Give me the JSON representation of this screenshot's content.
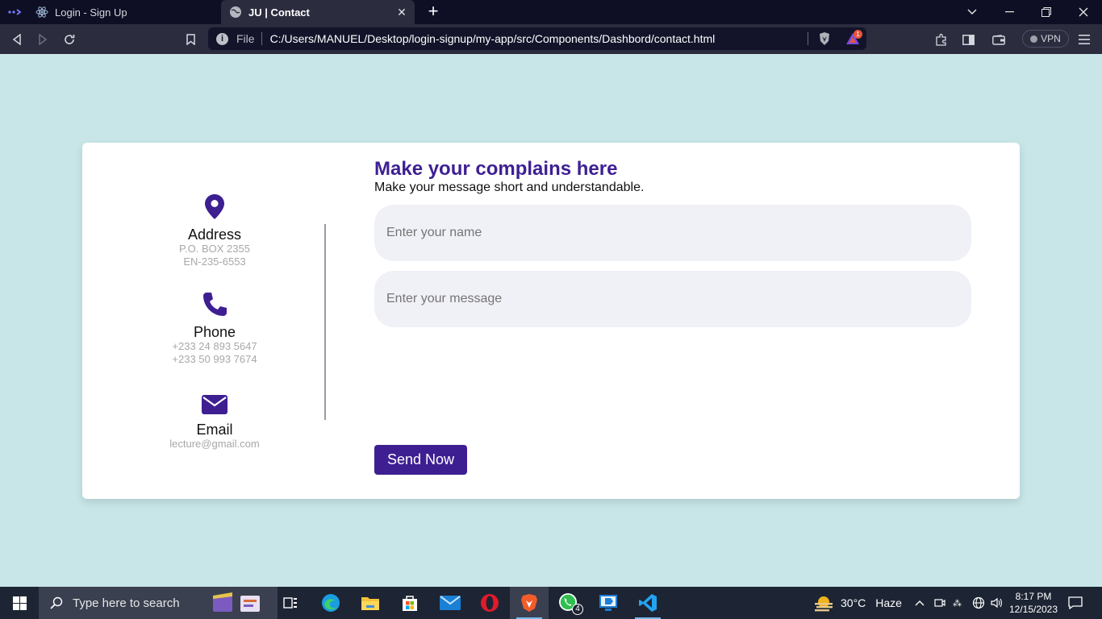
{
  "browser": {
    "tabs": [
      {
        "title": "Login - Sign Up",
        "active": false
      },
      {
        "title": "JU | Contact",
        "active": true
      }
    ],
    "url_scheme": "File",
    "url": "C:/Users/MANUEL/Desktop/login-signup/my-app/src/Components/Dashbord/contact.html",
    "vpn_label": "VPN",
    "rewards_badge": "1"
  },
  "contact_info": {
    "address": {
      "title": "Address",
      "lines": [
        "P.O. BOX 2355",
        "EN-235-6553"
      ],
      "icon": "map-pin-icon"
    },
    "phone": {
      "title": "Phone",
      "lines": [
        "+233 24 893 5647",
        "+233 50 993 7674"
      ],
      "icon": "phone-icon"
    },
    "email": {
      "title": "Email",
      "lines": [
        "lecture@gmail.com"
      ],
      "icon": "envelope-icon"
    }
  },
  "form": {
    "heading": "Make your complains here",
    "subheading": "Make your message short and understandable.",
    "name_placeholder": "Enter your name",
    "message_placeholder": "Enter your message",
    "submit_label": "Send Now"
  },
  "taskbar": {
    "search_placeholder": "Type here to search",
    "weather": {
      "temp": "30°C",
      "condition": "Haze"
    },
    "time": "8:17 PM",
    "date": "12/15/2023",
    "whatsapp_badge": "4"
  },
  "colors": {
    "accent": "#3e1f92",
    "page_bg": "#c8e6e8",
    "field_bg": "#f0f0f7"
  }
}
